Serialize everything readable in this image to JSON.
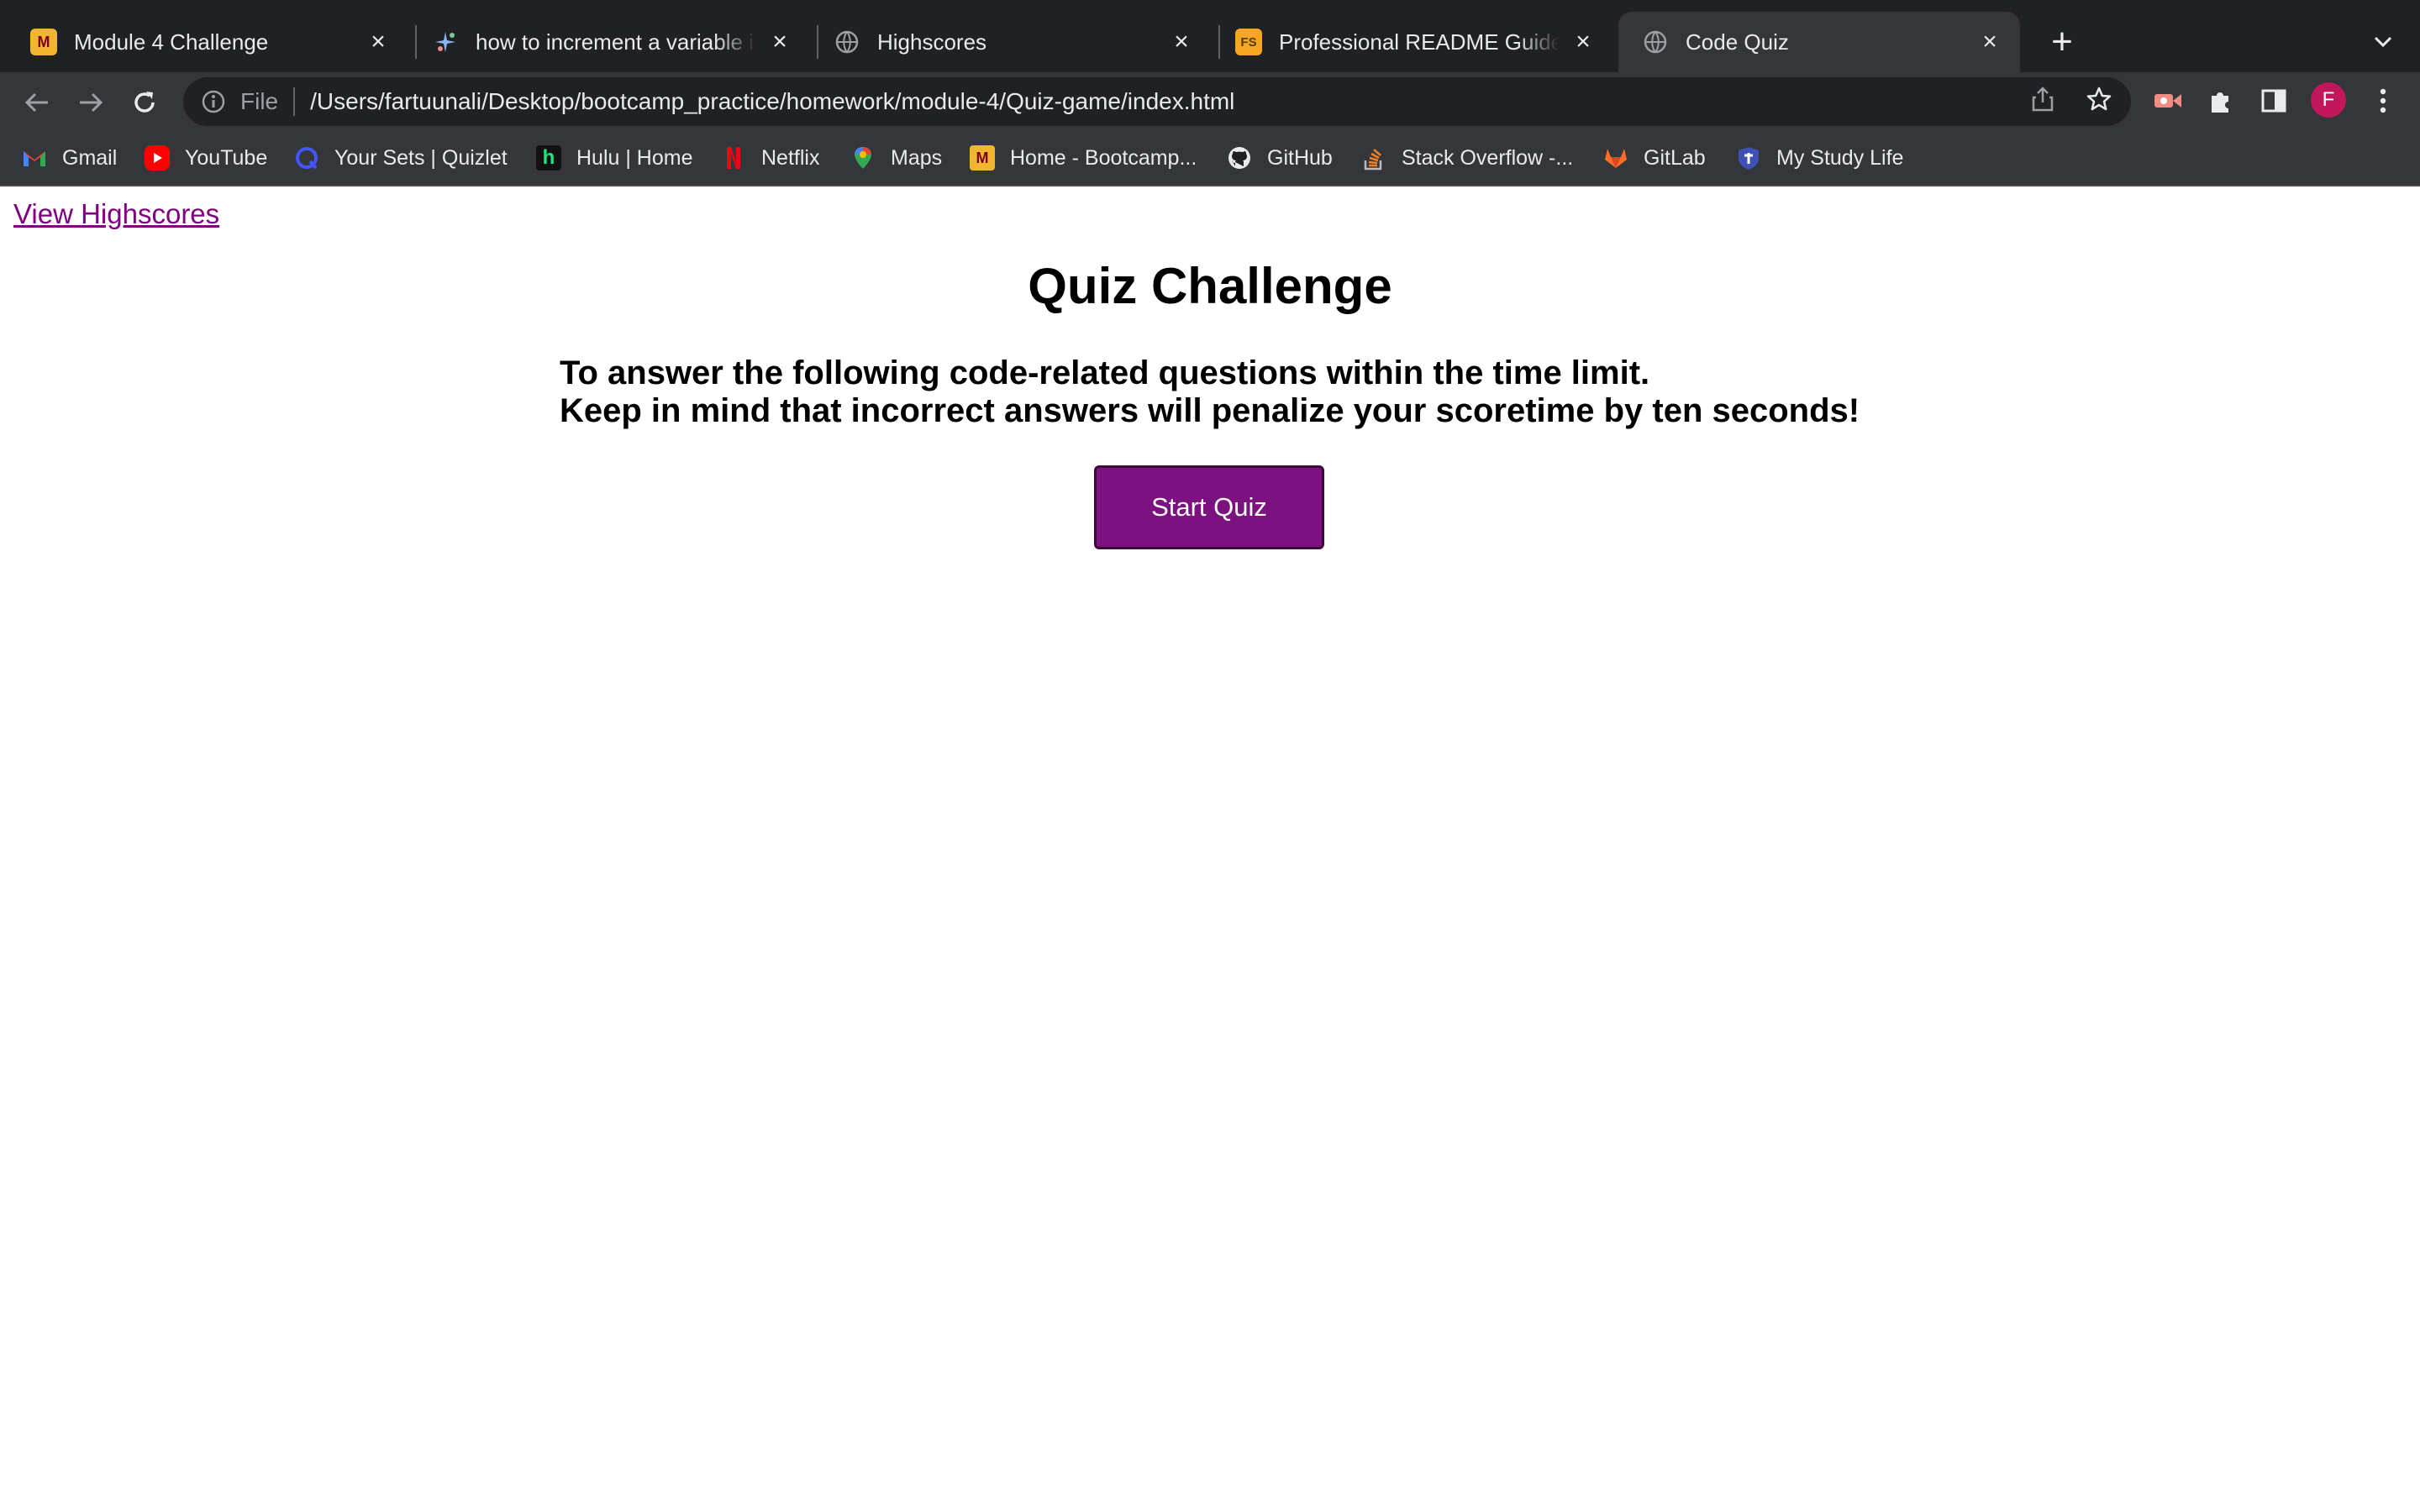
{
  "browser": {
    "tabs": [
      {
        "title": "Module 4 Challenge",
        "icon": "university-logo-icon"
      },
      {
        "title": "how to increment a variable in j",
        "icon": "sparkle-icon"
      },
      {
        "title": "Highscores",
        "icon": "globe-icon"
      },
      {
        "title": "Professional README Guide | T",
        "icon": "fs-logo-icon"
      },
      {
        "title": "Code Quiz",
        "icon": "globe-icon",
        "active": true
      }
    ],
    "address": {
      "scheme_label": "File",
      "url": "/Users/fartuunali/Desktop/bootcamp_practice/homework/module-4/Quiz-game/index.html"
    },
    "profile_initial": "F",
    "bookmarks": [
      {
        "label": "Gmail",
        "icon": "gmail-icon"
      },
      {
        "label": "YouTube",
        "icon": "youtube-icon"
      },
      {
        "label": "Your Sets | Quizlet",
        "icon": "quizlet-icon"
      },
      {
        "label": "Hulu | Home",
        "icon": "hulu-icon"
      },
      {
        "label": "Netflix",
        "icon": "netflix-icon"
      },
      {
        "label": "Maps",
        "icon": "maps-icon"
      },
      {
        "label": "Home - Bootcamp...",
        "icon": "university-logo-icon"
      },
      {
        "label": "GitHub",
        "icon": "github-icon"
      },
      {
        "label": "Stack Overflow -...",
        "icon": "stackoverflow-icon"
      },
      {
        "label": "GitLab",
        "icon": "gitlab-icon"
      },
      {
        "label": "My Study Life",
        "icon": "mystudylife-icon"
      }
    ]
  },
  "page": {
    "highscores_link": "View Highscores",
    "title": "Quiz Challenge",
    "description_line1": "To answer the following code-related questions within the time limit.",
    "description_line2": "Keep in mind that incorrect answers will penalize your scoretime by ten seconds!",
    "start_button": "Start Quiz"
  },
  "colors": {
    "link": "#800080",
    "start_button_bg": "#7b1280",
    "chrome_dark": "#202124",
    "chrome_toolbar": "#35363a"
  }
}
